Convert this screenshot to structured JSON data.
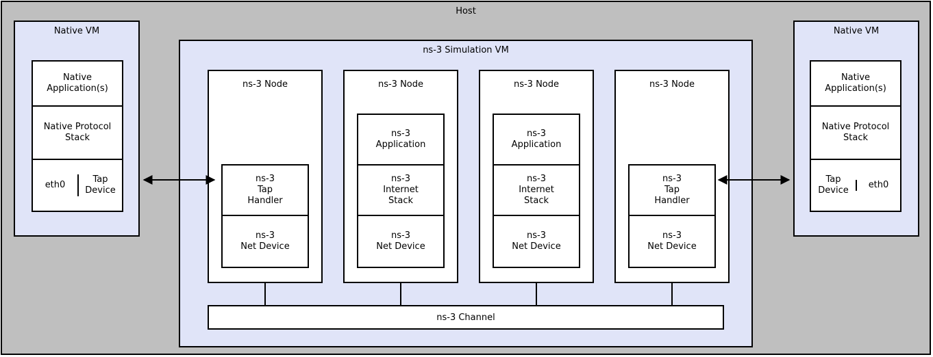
{
  "host_label": "Host",
  "native_vm": {
    "title": "Native VM",
    "apps": "Native\nApplication(s)",
    "proto": "Native\nProtocol\nStack",
    "eth": "eth0",
    "tap": "Tap\nDevice"
  },
  "sim_vm": {
    "title": "ns-3 Simulation VM",
    "node_title": "ns-3 Node",
    "tap_handler": "ns-3\nTap\nHandler",
    "net_device": "ns-3\nNet Device",
    "application": "ns-3\nApplication",
    "internet_stack": "ns-3\nInternet\nStack",
    "channel": "ns-3 Channel"
  }
}
